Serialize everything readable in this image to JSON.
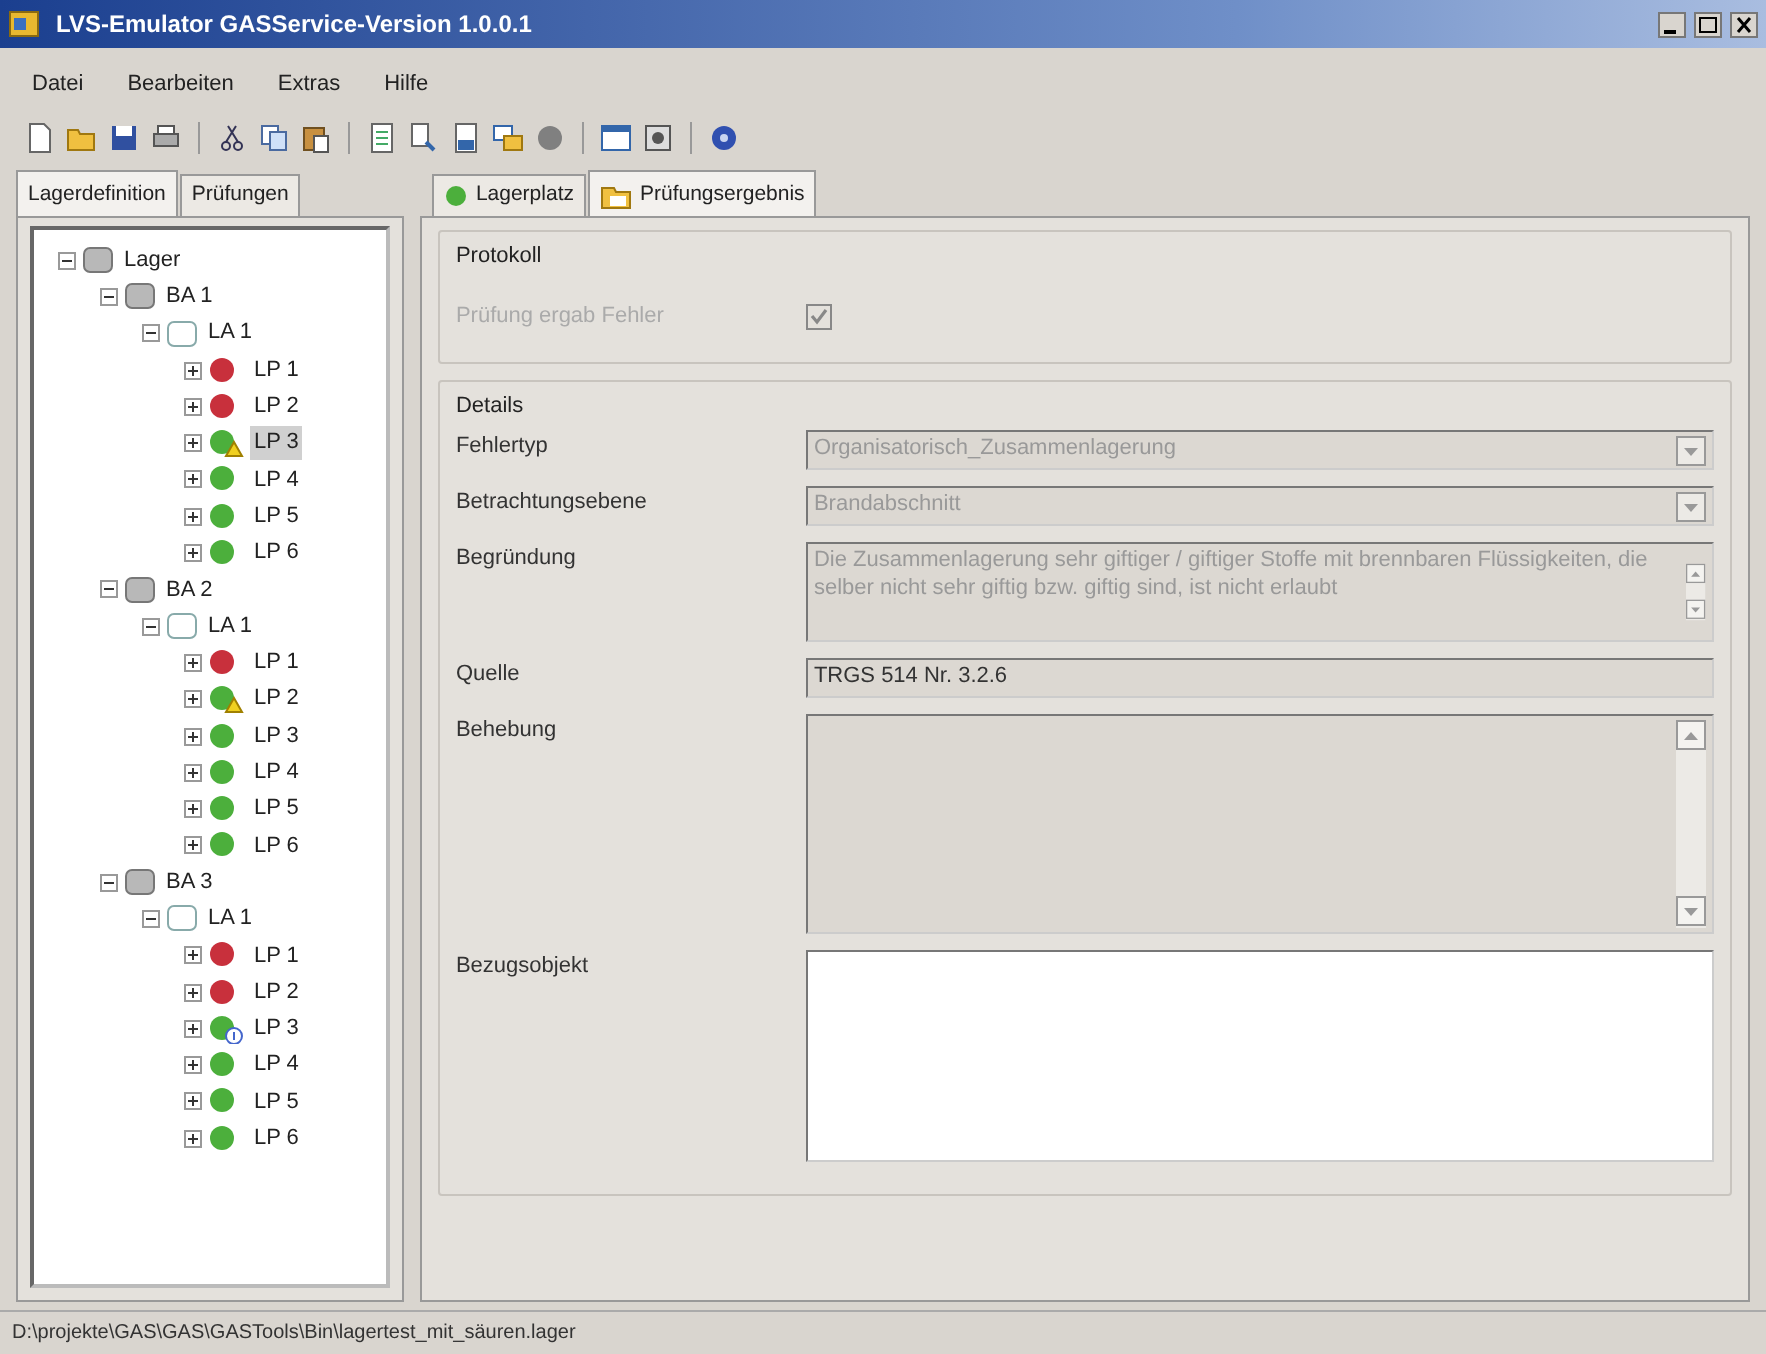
{
  "window": {
    "title": "LVS-Emulator GASService-Version 1.0.0.1"
  },
  "menu": [
    {
      "label": "Datei"
    },
    {
      "label": "Bearbeiten"
    },
    {
      "label": "Extras"
    },
    {
      "label": "Hilfe"
    }
  ],
  "left_tabs": [
    {
      "label": "Lagerdefinition",
      "selected": true
    },
    {
      "label": "Prüfungen",
      "selected": false
    }
  ],
  "tree": [
    {
      "label": "Lager",
      "kind": "root",
      "expanded": true,
      "selected": false,
      "children": [
        {
          "label": "BA 1",
          "kind": "section",
          "expanded": true,
          "selected": false,
          "children": [
            {
              "label": "LA 1",
              "kind": "area",
              "expanded": true,
              "selected": false,
              "children": [
                {
                  "label": "LP 1",
                  "kind": "place",
                  "color": "#c8303c",
                  "expanded": false,
                  "selected": false
                },
                {
                  "label": "LP 2",
                  "kind": "place",
                  "color": "#c8303c",
                  "expanded": false,
                  "selected": false
                },
                {
                  "label": "LP 3",
                  "kind": "warning",
                  "color": "#4caf3c",
                  "expanded": false,
                  "selected": true
                },
                {
                  "label": "LP 4",
                  "kind": "place",
                  "color": "#4caf3c",
                  "expanded": false,
                  "selected": false
                },
                {
                  "label": "LP 5",
                  "kind": "place",
                  "color": "#4caf3c",
                  "expanded": false,
                  "selected": false
                },
                {
                  "label": "LP 6",
                  "kind": "place",
                  "color": "#4caf3c",
                  "expanded": false,
                  "selected": false
                }
              ]
            }
          ]
        },
        {
          "label": "BA 2",
          "kind": "section",
          "expanded": true,
          "selected": false,
          "children": [
            {
              "label": "LA 1",
              "kind": "area",
              "expanded": true,
              "selected": false,
              "children": [
                {
                  "label": "LP 1",
                  "kind": "place",
                  "color": "#c8303c",
                  "expanded": false,
                  "selected": false
                },
                {
                  "label": "LP 2",
                  "kind": "warning",
                  "color": "#4caf3c",
                  "expanded": false,
                  "selected": false
                },
                {
                  "label": "LP 3",
                  "kind": "place",
                  "color": "#4caf3c",
                  "expanded": false,
                  "selected": false
                },
                {
                  "label": "LP 4",
                  "kind": "place",
                  "color": "#4caf3c",
                  "expanded": false,
                  "selected": false
                },
                {
                  "label": "LP 5",
                  "kind": "place",
                  "color": "#4caf3c",
                  "expanded": false,
                  "selected": false
                },
                {
                  "label": "LP 6",
                  "kind": "place",
                  "color": "#4caf3c",
                  "expanded": false,
                  "selected": false
                }
              ]
            }
          ]
        },
        {
          "label": "BA 3",
          "kind": "section",
          "expanded": true,
          "selected": false,
          "children": [
            {
              "label": "LA 1",
              "kind": "area",
              "expanded": true,
              "selected": false,
              "children": [
                {
                  "label": "LP 1",
                  "kind": "place",
                  "color": "#c8303c",
                  "expanded": false,
                  "selected": false
                },
                {
                  "label": "LP 2",
                  "kind": "place",
                  "color": "#c8303c",
                  "expanded": false,
                  "selected": false
                },
                {
                  "label": "LP 3",
                  "kind": "info",
                  "color": "#4caf3c",
                  "expanded": false,
                  "selected": false
                },
                {
                  "label": "LP 4",
                  "kind": "place",
                  "color": "#4caf3c",
                  "expanded": false,
                  "selected": false
                },
                {
                  "label": "LP 5",
                  "kind": "place",
                  "color": "#4caf3c",
                  "expanded": false,
                  "selected": false
                },
                {
                  "label": "LP 6",
                  "kind": "place",
                  "color": "#4caf3c",
                  "expanded": false,
                  "selected": false
                }
              ]
            }
          ]
        }
      ]
    }
  ],
  "right_tabs": [
    {
      "label": "Lagerplatz",
      "kind": "status",
      "selected": false
    },
    {
      "label": "Prüfungsergebnis",
      "kind": "folder",
      "selected": true
    }
  ],
  "protokoll": {
    "title": "Protokoll",
    "label": "Prüfung ergab Fehler",
    "checked": true,
    "disabled": true
  },
  "details": {
    "title": "Details",
    "fields": [
      {
        "label": "Fehlertyp",
        "kind": "combo",
        "value": "Organisatorisch_Zusammenlagerung",
        "disabled": true
      },
      {
        "label": "Betrachtungsebene",
        "kind": "combo",
        "value": "Brandabschnitt",
        "disabled": true
      },
      {
        "label": "Begründung",
        "kind": "memo",
        "value": "Die Zusammenlagerung sehr giftiger / giftiger Stoffe mit brennbaren Flüssigkeiten, die selber nicht sehr giftig bzw. giftig sind, ist nicht erlaubt",
        "disabled": true
      },
      {
        "label": "Quelle",
        "kind": "text",
        "value": "TRGS 514 Nr. 3.2.6",
        "disabled": true
      },
      {
        "label": "Behebung",
        "kind": "bigmemo",
        "disabled": true
      },
      {
        "label": "Bezugsobjekt",
        "kind": "list",
        "disabled": false
      }
    ]
  },
  "status_bar": "D:\\projekte\\GAS\\GAS\\GASTools\\Bin\\lagertest_mit_säuren.lager"
}
